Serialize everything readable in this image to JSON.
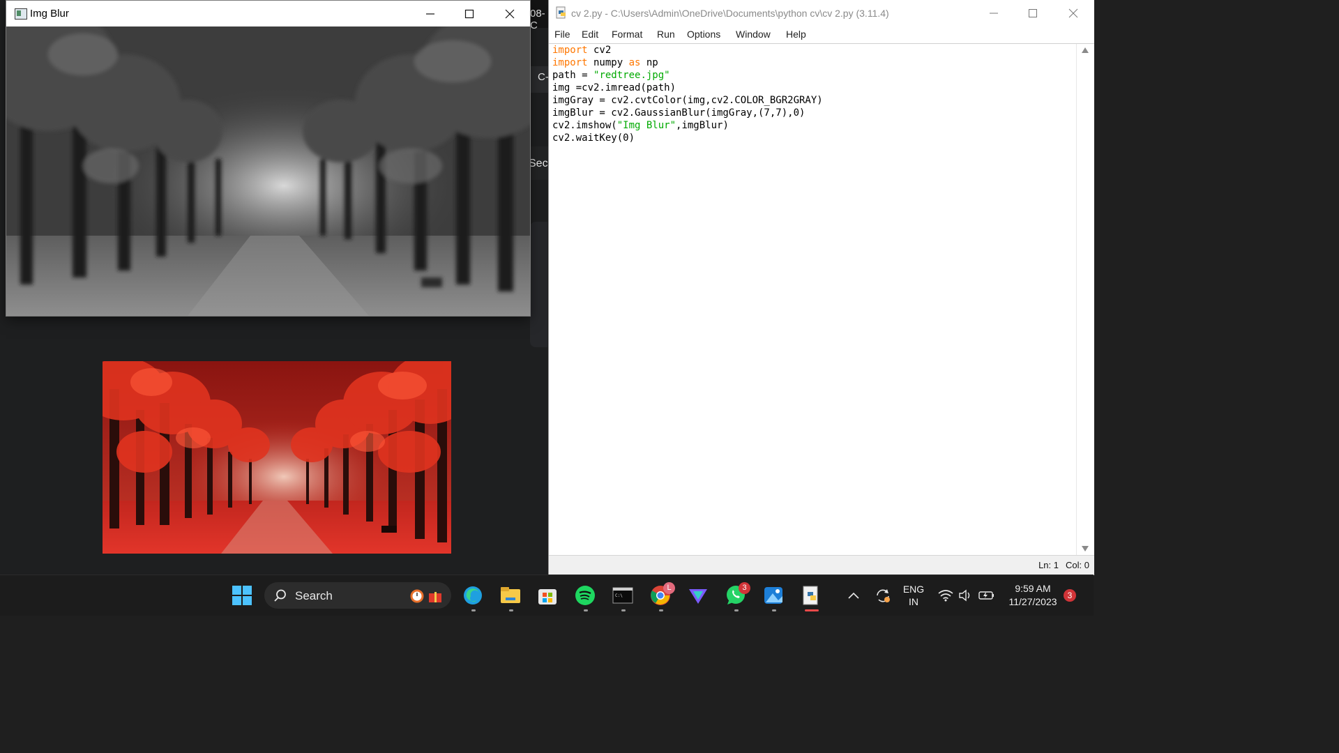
{
  "background": {
    "frag_top": "08-C",
    "frag_tab": "C-",
    "frag_sec": "Secu"
  },
  "blur_window": {
    "title": "Img Blur",
    "minimize_icon": "minimize-icon",
    "maximize_icon": "maximize-icon",
    "close_icon": "close-icon"
  },
  "idle_window": {
    "title": "cv 2.py - C:\\Users\\Admin\\OneDrive\\Documents\\python cv\\cv 2.py (3.11.4)",
    "menu": [
      "File",
      "Edit",
      "Format",
      "Run",
      "Options",
      "Window",
      "Help"
    ],
    "code": [
      {
        "kw": "import",
        "rest": " cv2"
      },
      {
        "kw": "import",
        "rest": " numpy ",
        "kw2": "as",
        "rest2": " np"
      },
      {
        "pre": "path = ",
        "str": "\"redtree.jpg\""
      },
      {
        "pre": "img =cv2.imread(path)"
      },
      {
        "pre": "imgGray = cv2.cvtColor(img,cv2.COLOR_BGR2GRAY)"
      },
      {
        "pre": "imgBlur = cv2.GaussianBlur(imgGray,(7,7),0)"
      },
      {
        "pre": "cv2.imshow(",
        "str": "\"Img Blur\"",
        "post": ",imgBlur)"
      },
      {
        "pre": "cv2.waitKey(0)"
      }
    ],
    "status": {
      "ln": "Ln: 1",
      "col": "Col: 0"
    }
  },
  "taskbar": {
    "search_label": "Search",
    "apps": [
      "start-icon",
      "edge-icon",
      "file-explorer-icon",
      "store-icon",
      "spotify-icon",
      "terminal-icon",
      "chrome-icon",
      "proton-vpn-icon",
      "whatsapp-icon",
      "photos-icon",
      "python-idle-icon"
    ],
    "chrome_badge": "L",
    "whatsapp_badge": "3",
    "language_line1": "ENG",
    "language_line2": "IN",
    "time": "9:59 AM",
    "date": "11/27/2023",
    "notification_count": "3"
  },
  "colors": {
    "keyword": "#ff7700",
    "string": "#00aa00",
    "taskbar": "#1c1c1c",
    "badge": "#d13438"
  }
}
